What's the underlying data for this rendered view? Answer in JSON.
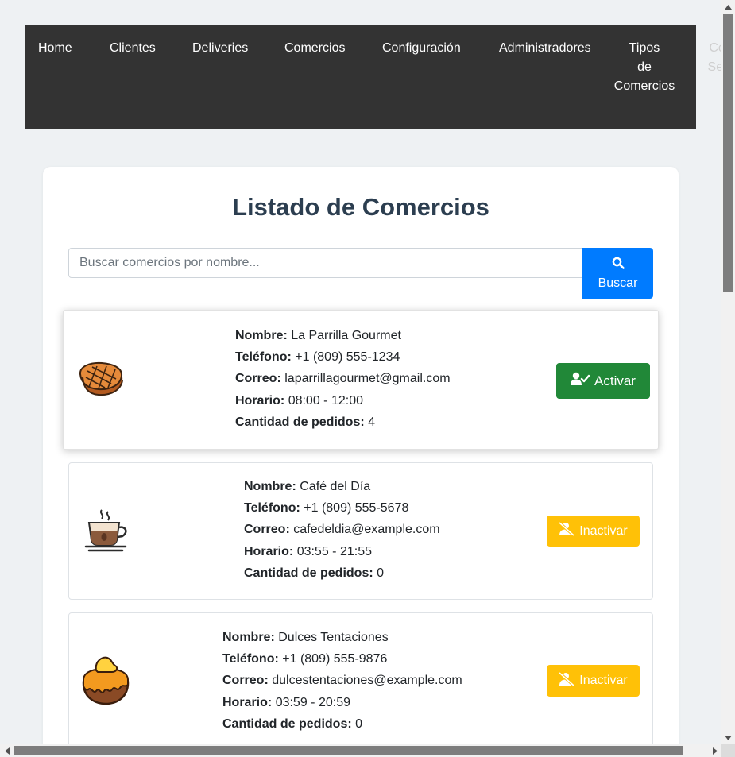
{
  "nav": {
    "items": [
      {
        "label": "Home"
      },
      {
        "label": "Clientes"
      },
      {
        "label": "Deliveries"
      },
      {
        "label": "Comercios"
      },
      {
        "label": "Configuración"
      },
      {
        "label": "Administradores"
      },
      {
        "label": "Tipos de Comercios"
      },
      {
        "label": "Cerrar Sesión"
      }
    ]
  },
  "page": {
    "title": "Listado de Comercios"
  },
  "search": {
    "placeholder": "Buscar comercios por nombre...",
    "button_label": "Buscar",
    "button_icon": "search-icon"
  },
  "field_labels": {
    "name": "Nombre:",
    "phone": "Teléfono:",
    "email": "Correo:",
    "hours": "Horario:",
    "orders": "Cantidad de pedidos:"
  },
  "commerces": [
    {
      "name": "La Parrilla Gourmet",
      "phone": "+1 (809) 555-1234",
      "email": "laparrillagourmet@gmail.com",
      "hours": "08:00 - 12:00",
      "orders": "4",
      "logo_icon": "steak-icon",
      "action_label": "Activar",
      "action_icon": "user-check-icon",
      "action_color": "#218838"
    },
    {
      "name": "Café del Día",
      "phone": "+1 (809) 555-5678",
      "email": "cafedeldia@example.com",
      "hours": "03:55 - 21:55",
      "orders": "0",
      "logo_icon": "coffee-cup-icon",
      "action_label": "Inactivar",
      "action_icon": "user-slash-icon",
      "action_color": "#ffc107"
    },
    {
      "name": "Dulces Tentaciones",
      "phone": "+1 (809) 555-9876",
      "email": "dulcestentaciones@example.com",
      "hours": "03:59 - 20:59",
      "orders": "0",
      "logo_icon": "dessert-icon",
      "action_label": "Inactivar",
      "action_icon": "user-slash-icon",
      "action_color": "#ffc107"
    }
  ],
  "colors": {
    "nav_bg": "#333333",
    "primary": "#007bff",
    "success": "#218838",
    "warning": "#ffc107",
    "title": "#2c3e50",
    "page_bg": "#eef1f3"
  }
}
